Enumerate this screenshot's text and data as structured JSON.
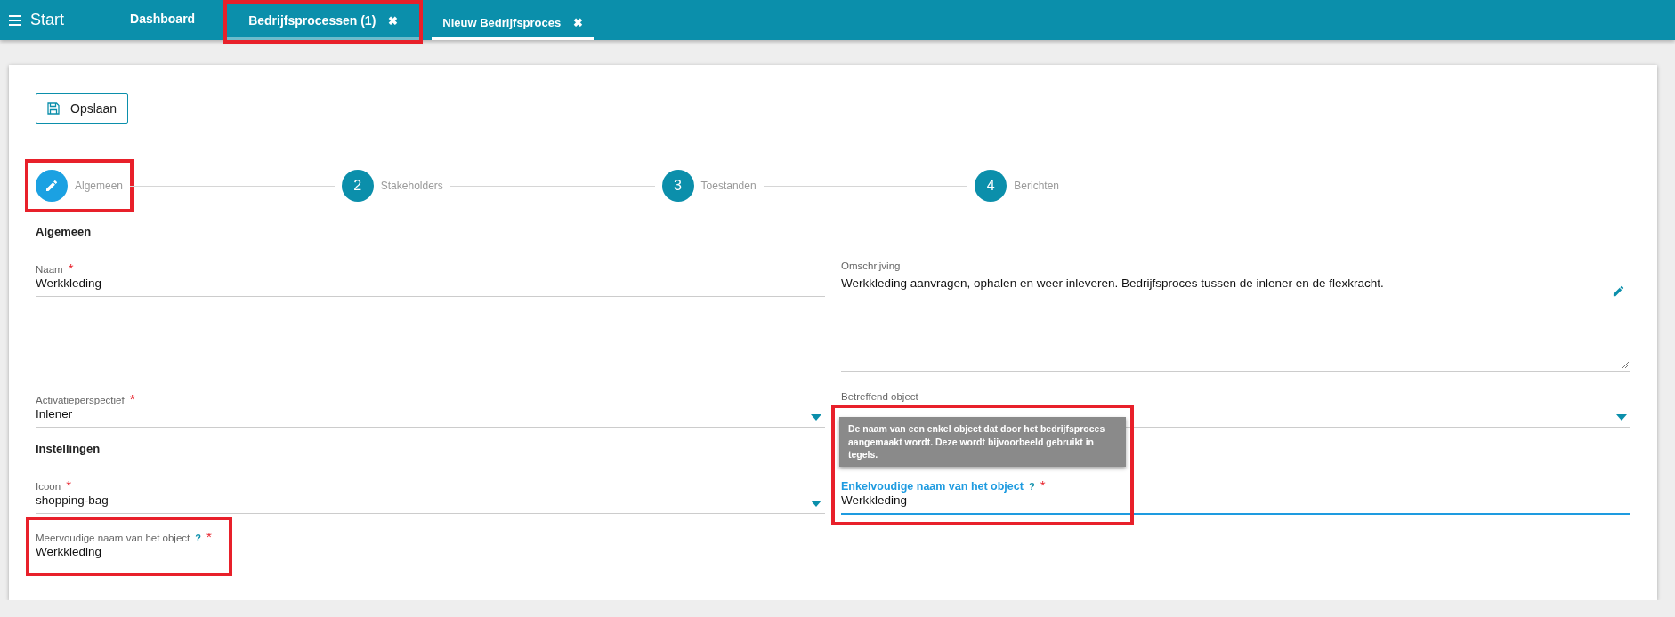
{
  "nav": {
    "menu_label": "Start",
    "tabs": [
      {
        "label": "Dashboard",
        "selected": false
      },
      {
        "label": "Bedrijfsprocessen (1)",
        "close": "✖",
        "selected": false,
        "highlighted": true
      },
      {
        "label": "Nieuw Bedrijfsproces",
        "close": "✖",
        "selected": true
      }
    ]
  },
  "toolbar": {
    "save_label": "Opslaan"
  },
  "steps": [
    {
      "label": "Algemeen",
      "active": true,
      "highlighted": true
    },
    {
      "number": "2",
      "label": "Stakeholders",
      "active": false
    },
    {
      "number": "3",
      "label": "Toestanden",
      "active": false
    },
    {
      "number": "4",
      "label": "Berichten",
      "active": false
    }
  ],
  "sections": [
    {
      "title": "Algemeen",
      "fields": [
        {
          "kind": "text",
          "label": "Naam",
          "required_mark": "*",
          "value": "Werkkleding",
          "focused": false
        },
        {
          "kind": "textarea",
          "label": "Omschrijving",
          "value": "Werkkleding aanvragen, ophalen en weer inleveren. Bedrijfsproces tussen de inlener en de flexkracht.",
          "focused": false
        },
        {
          "kind": "select",
          "label": "Activatieperspectief",
          "required_mark": "*",
          "value": "Inlener",
          "focused": false
        },
        {
          "kind": "select",
          "label": "Betreffend object",
          "focused": false
        }
      ]
    },
    {
      "title": "Instellingen",
      "fields": [
        {
          "kind": "select",
          "label": "Icoon",
          "required_mark": "*",
          "value": "shopping-bag",
          "focused": false
        },
        {
          "kind": "text",
          "label": "Enkelvoudige naam van het object",
          "help": "?",
          "required_mark": "*",
          "value": "Werkkleding",
          "focused": true,
          "highlighted": true,
          "tooltip": "De naam van een enkel object dat door het bedrijfsproces aangemaakt wordt. Deze wordt bijvoorbeeld gebruikt in tegels."
        },
        {
          "kind": "text",
          "label": "Meervoudige naam van het object",
          "help": "?",
          "required_mark": "*",
          "value": "Werkkleding",
          "focused": false,
          "highlighted": true
        }
      ]
    }
  ]
}
